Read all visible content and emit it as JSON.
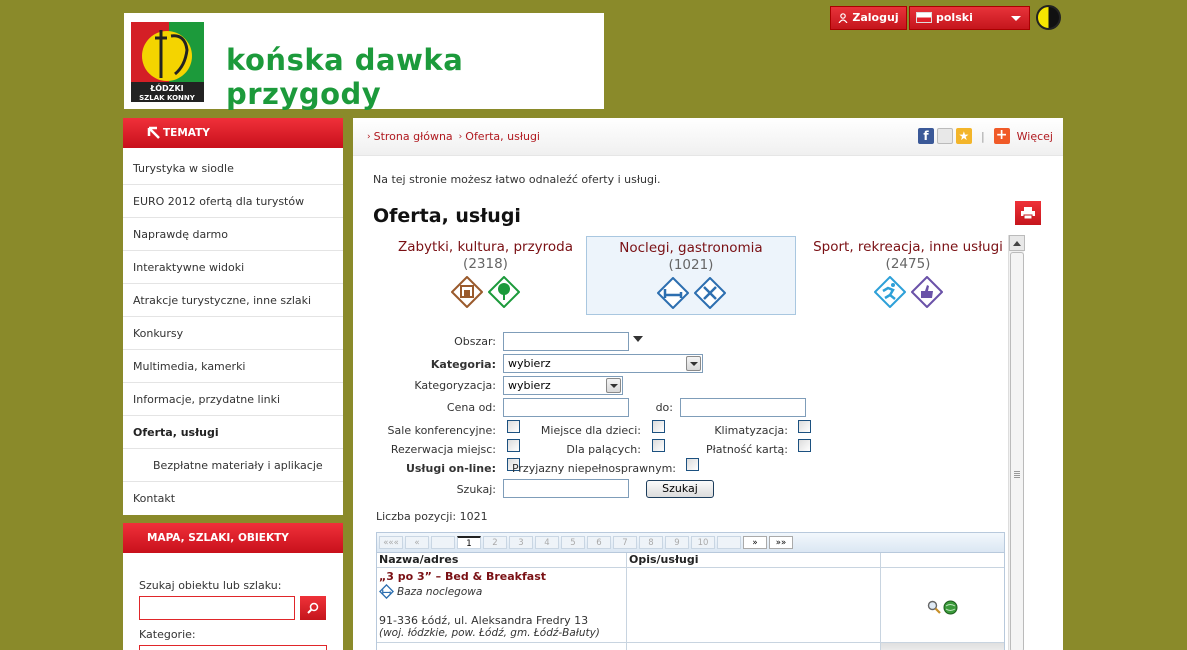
{
  "header": {
    "logo_line1": "ŁÓDZKI",
    "logo_line2": "SZLAK KONNY",
    "slogan": "końska dawka przygody",
    "login_label": "Zaloguj",
    "language": "polski"
  },
  "sidebar": {
    "menu_title": "TEMATY",
    "items": [
      {
        "label": "Turystyka w siodle"
      },
      {
        "label": "EURO 2012 ofertą dla turystów"
      },
      {
        "label": "Naprawdę darmo"
      },
      {
        "label": "Interaktywne widoki"
      },
      {
        "label": "Atrakcje turystyczne, inne szlaki"
      },
      {
        "label": "Konkursy"
      },
      {
        "label": "Multimedia, kamerki"
      },
      {
        "label": "Informacje, przydatne linki"
      },
      {
        "label": "Oferta, usługi"
      },
      {
        "label": "Bezpłatne materiały i aplikacje"
      },
      {
        "label": "Kontakt"
      }
    ],
    "map_title": "MAPA, SZLAKI, OBIEKTY",
    "map_search_label": "Szukaj obiektu lub szlaku:",
    "map_category_label": "Kategorie:"
  },
  "breadcrumb": {
    "home": "Strona główna",
    "current": "Oferta, usługi"
  },
  "share": {
    "more_label": "Więcej"
  },
  "page": {
    "intro": "Na tej stronie możesz łatwo odnaleźć oferty i usługi.",
    "title": "Oferta, usługi"
  },
  "categories": [
    {
      "name": "Zabytki, kultura, przyroda",
      "count": "(2318)"
    },
    {
      "name": "Noclegi, gastronomia",
      "count": "(1021)"
    },
    {
      "name": "Sport, rekreacja, inne usługi",
      "count": "(2475)"
    }
  ],
  "form": {
    "obszar_label": "Obszar:",
    "obszar_value": "",
    "kategoria_label": "Kategoria:",
    "kategoria_value": "wybierz",
    "kategoryzacja_label": "Kategoryzacja:",
    "kategoryzacja_value": "wybierz",
    "cena_od_label": "Cena od:",
    "cena_do_label": "do:",
    "checkboxes": [
      {
        "label": "Sale konferencyjne:"
      },
      {
        "label": "Miejsce dla dzieci:"
      },
      {
        "label": "Klimatyzacja:"
      },
      {
        "label": "Rezerwacja miejsc:"
      },
      {
        "label": "Dla palących:"
      },
      {
        "label": "Płatność kartą:"
      },
      {
        "label": "Usługi on-line:"
      },
      {
        "label": "Przyjazny niepełnosprawnym:"
      }
    ],
    "szukaj_label": "Szukaj:",
    "search_button": "Szukaj"
  },
  "results": {
    "count_text": "Liczba pozycji: 1021",
    "pager": [
      "«««",
      "«",
      "",
      "1",
      "2",
      "3",
      "4",
      "5",
      "6",
      "7",
      "8",
      "9",
      "10",
      "",
      "»",
      "»»"
    ],
    "columns": [
      "Nazwa/adres",
      "Opis/usługi",
      ""
    ],
    "rows": [
      {
        "name": "„3 po 3” – Bed & Breakfast",
        "type": "Baza noclegowa",
        "address": "91-336 Łódź, ul. Aleksandra Fredry 13",
        "region": "(woj. łódzkie, pow. Łódź, gm. Łódź-Bałuty)"
      }
    ]
  },
  "colors": {
    "background": "#8a8a2a",
    "accent": "#d41f26",
    "link": "#b0191f",
    "category_title": "#7a1014",
    "logo_green": "#1c9a3b"
  }
}
